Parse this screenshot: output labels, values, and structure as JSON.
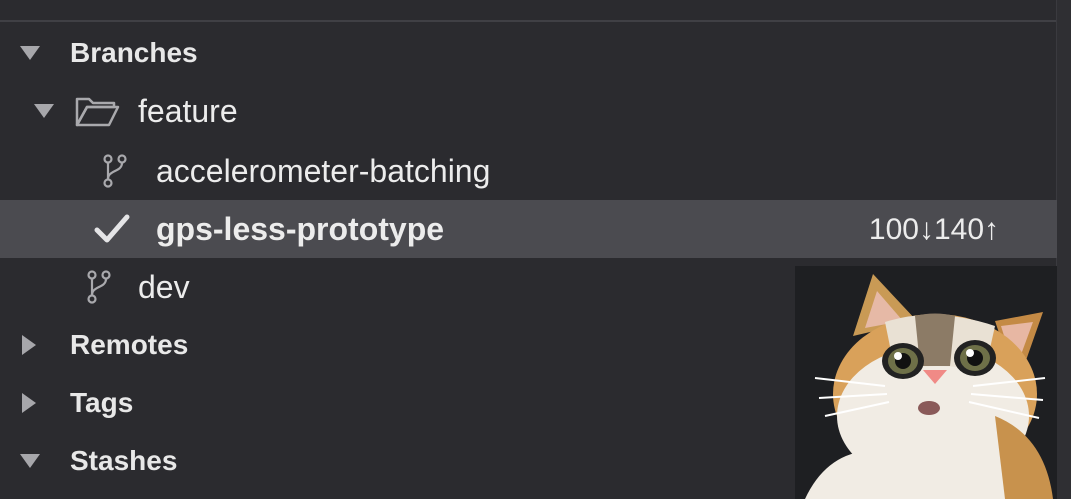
{
  "sidebar": {
    "sections": [
      {
        "label": "Branches",
        "state": "expanded"
      },
      {
        "label": "Remotes",
        "state": "collapsed"
      },
      {
        "label": "Tags",
        "state": "collapsed"
      },
      {
        "label": "Stashes",
        "state": "expanded"
      }
    ],
    "folder": {
      "label": "feature",
      "icon": "folder-icon"
    },
    "branches": [
      {
        "label": "accelerometer-batching",
        "icon": "branch-icon"
      },
      {
        "label": "gps-less-prototype",
        "icon": "checkmark-icon",
        "selected": true,
        "counts": "100↓140↑"
      },
      {
        "label": "dev",
        "icon": "branch-icon"
      }
    ]
  },
  "colors": {
    "background": "#2b2b2f",
    "selected_row": "#4b4b50",
    "text": "#ececec",
    "disclosure": "#a7a7ab"
  },
  "image": {
    "description_icon": "surprised-cat-image"
  }
}
